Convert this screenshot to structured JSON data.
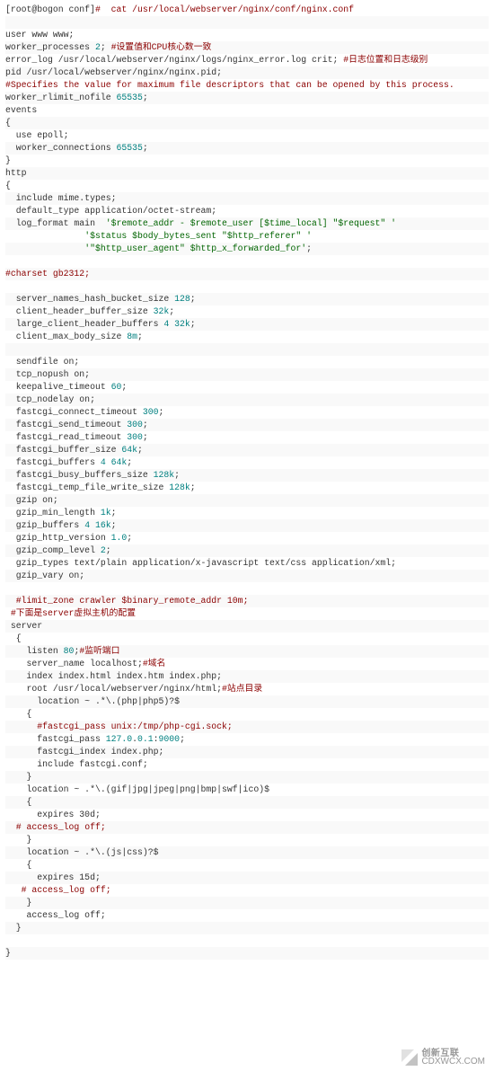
{
  "watermark": {
    "line1": "创新互联",
    "line2": "CDXWCX.COM"
  },
  "raw_lines": [
    "[root@bogon conf]#  cat /usr/local/webserver/nginx/conf/nginx.conf",
    "",
    "user www www;",
    "worker_processes 2; #设置值和CPU核心数一致",
    "error_log /usr/local/webserver/nginx/logs/nginx_error.log crit; #日志位置和日志级别",
    "pid /usr/local/webserver/nginx/nginx.pid;",
    "#Specifies the value for maximum file descriptors that can be opened by this process.",
    "worker_rlimit_nofile 65535;",
    "events",
    "{",
    "  use epoll;",
    "  worker_connections 65535;",
    "}",
    "http",
    "{",
    "  include mime.types;",
    "  default_type application/octet-stream;",
    "  log_format main  '$remote_addr - $remote_user [$time_local] \"$request\" '",
    "               '$status $body_bytes_sent \"$http_referer\" '",
    "               '\"$http_user_agent\" $http_x_forwarded_for';",
    "",
    "#charset gb2312;",
    "",
    "  server_names_hash_bucket_size 128;",
    "  client_header_buffer_size 32k;",
    "  large_client_header_buffers 4 32k;",
    "  client_max_body_size 8m;",
    "",
    "  sendfile on;",
    "  tcp_nopush on;",
    "  keepalive_timeout 60;",
    "  tcp_nodelay on;",
    "  fastcgi_connect_timeout 300;",
    "  fastcgi_send_timeout 300;",
    "  fastcgi_read_timeout 300;",
    "  fastcgi_buffer_size 64k;",
    "  fastcgi_buffers 4 64k;",
    "  fastcgi_busy_buffers_size 128k;",
    "  fastcgi_temp_file_write_size 128k;",
    "  gzip on;",
    "  gzip_min_length 1k;",
    "  gzip_buffers 4 16k;",
    "  gzip_http_version 1.0;",
    "  gzip_comp_level 2;",
    "  gzip_types text/plain application/x-javascript text/css application/xml;",
    "  gzip_vary on;",
    "",
    "  #limit_zone crawler $binary_remote_addr 10m;",
    " #下面是server虚拟主机的配置",
    " server",
    "  {",
    "    listen 80;#监听端口",
    "    server_name localhost;#域名",
    "    index index.html index.htm index.php;",
    "    root /usr/local/webserver/nginx/html;#站点目录",
    "      location ~ .*\\.(php|php5)?$",
    "    {",
    "      #fastcgi_pass unix:/tmp/php-cgi.sock;",
    "      fastcgi_pass 127.0.0.1:9000;",
    "      fastcgi_index index.php;",
    "      include fastcgi.conf;",
    "    }",
    "    location ~ .*\\.(gif|jpg|jpeg|png|bmp|swf|ico)$",
    "    {",
    "      expires 30d;",
    "  # access_log off;",
    "    }",
    "    location ~ .*\\.(js|css)?$",
    "    {",
    "      expires 15d;",
    "   # access_log off;",
    "    }",
    "    access_log off;",
    "  }",
    "",
    "}"
  ]
}
